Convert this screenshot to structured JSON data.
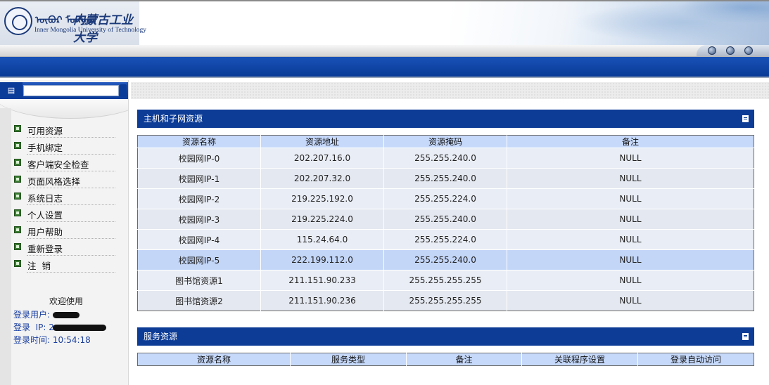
{
  "header": {
    "logo_text_mongolian": "ᠥᠪᠦᠷ ᠮᠣᠩᠭᠣᠯ",
    "logo_text_cn": "内蒙古工业大学",
    "logo_text_en": "Inner Mongolia University of Technology",
    "window_controls": [
      "minimize",
      "restore",
      "close"
    ]
  },
  "sidebar": {
    "menu": [
      {
        "label": "可用资源",
        "icon": "list-item-icon"
      },
      {
        "label": "手机绑定",
        "icon": "list-item-icon"
      },
      {
        "label": "客户端安全检查",
        "icon": "list-item-icon"
      },
      {
        "label": "页面风格选择",
        "icon": "list-item-icon"
      },
      {
        "label": "系统日志",
        "icon": "list-item-icon"
      },
      {
        "label": "个人设置",
        "icon": "list-item-icon"
      },
      {
        "label": "用户帮助",
        "icon": "list-item-icon"
      },
      {
        "label": "重新登录",
        "icon": "list-item-icon"
      },
      {
        "label": "注  销",
        "icon": "list-item-icon"
      }
    ],
    "welcome": {
      "title": "欢迎使用",
      "user_label": "登录用户:",
      "ip_label": "登录  IP:",
      "ip_visible_prefix": "2",
      "time_label": "登录时间:",
      "time_value": "10:54:18"
    }
  },
  "hosts_panel": {
    "title": "主机和子网资源",
    "columns": [
      "资源名称",
      "资源地址",
      "资源掩码",
      "备注"
    ],
    "rows": [
      {
        "name": "校园网IP-0",
        "address": "202.207.16.0",
        "mask": "255.255.240.0",
        "note": "NULL"
      },
      {
        "name": "校园网IP-1",
        "address": "202.207.32.0",
        "mask": "255.255.240.0",
        "note": "NULL"
      },
      {
        "name": "校园网IP-2",
        "address": "219.225.192.0",
        "mask": "255.255.224.0",
        "note": "NULL"
      },
      {
        "name": "校园网IP-3",
        "address": "219.225.224.0",
        "mask": "255.255.240.0",
        "note": "NULL"
      },
      {
        "name": "校园网IP-4",
        "address": "115.24.64.0",
        "mask": "255.255.224.0",
        "note": "NULL"
      },
      {
        "name": "校园网IP-5",
        "address": "222.199.112.0",
        "mask": "255.255.240.0",
        "note": "NULL"
      },
      {
        "name": "图书馆资源1",
        "address": "211.151.90.233",
        "mask": "255.255.255.255",
        "note": "NULL"
      },
      {
        "name": "图书馆资源2",
        "address": "211.151.90.236",
        "mask": "255.255.255.255",
        "note": "NULL"
      }
    ],
    "selected_row": 5
  },
  "services_panel": {
    "title": "服务资源",
    "columns": [
      "资源名称",
      "服务类型",
      "备注",
      "关联程序设置",
      "登录自动访问"
    ]
  }
}
